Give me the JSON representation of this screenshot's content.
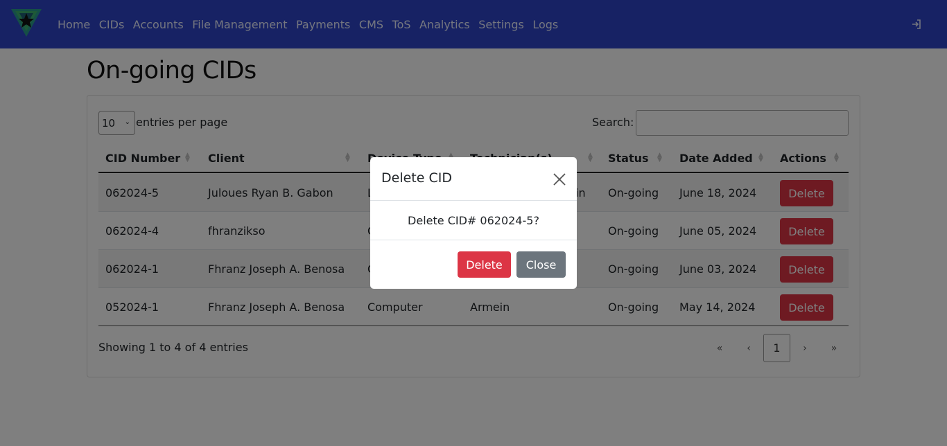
{
  "nav": {
    "items": [
      "Home",
      "CIDs",
      "Accounts",
      "File Management",
      "Payments",
      "CMS",
      "ToS",
      "Analytics",
      "Settings",
      "Logs"
    ],
    "logo_icon": "app-logo",
    "logout_icon": "logout-icon"
  },
  "page": {
    "title": "On-going CIDs"
  },
  "table_controls": {
    "entries_value": "10",
    "entries_label": "entries per page",
    "search_label": "Search:",
    "search_value": ""
  },
  "table": {
    "columns": [
      "CID Number",
      "Client",
      "Device Type",
      "Technician(s)",
      "Status",
      "Date Added",
      "Actions"
    ],
    "rows": [
      {
        "cid": "062024-5",
        "client": "Julouеs Ryan B. Gabon",
        "device": "L",
        "tech": "in",
        "status": "On-going",
        "date": "June 18, 2024",
        "action": "Delete"
      },
      {
        "cid": "062024-4",
        "client": "fhranzikso",
        "device": "C",
        "tech": "",
        "status": "On-going",
        "date": "June 05, 2024",
        "action": "Delete"
      },
      {
        "cid": "062024-1",
        "client": "Fhranz Joseph A. Benosa",
        "device": "C",
        "tech": "",
        "status": "On-going",
        "date": "June 03, 2024",
        "action": "Delete"
      },
      {
        "cid": "052024-1",
        "client": "Fhranz Joseph A. Benosa",
        "device": "Computer",
        "tech": "Armein",
        "status": "On-going",
        "date": "May 14, 2024",
        "action": "Delete"
      }
    ],
    "info": "Showing 1 to 4 of 4 entries",
    "pagination": {
      "first": "«",
      "prev": "‹",
      "current": "1",
      "next": "›",
      "last": "»"
    }
  },
  "modal": {
    "title": "Delete CID",
    "message": "Delete CID# 062024-5?",
    "delete_label": "Delete",
    "close_label": "Close",
    "close_icon": "close-icon"
  },
  "colors": {
    "navbar": "#2e44c8",
    "danger": "#dc3545",
    "secondary": "#6c757d"
  }
}
